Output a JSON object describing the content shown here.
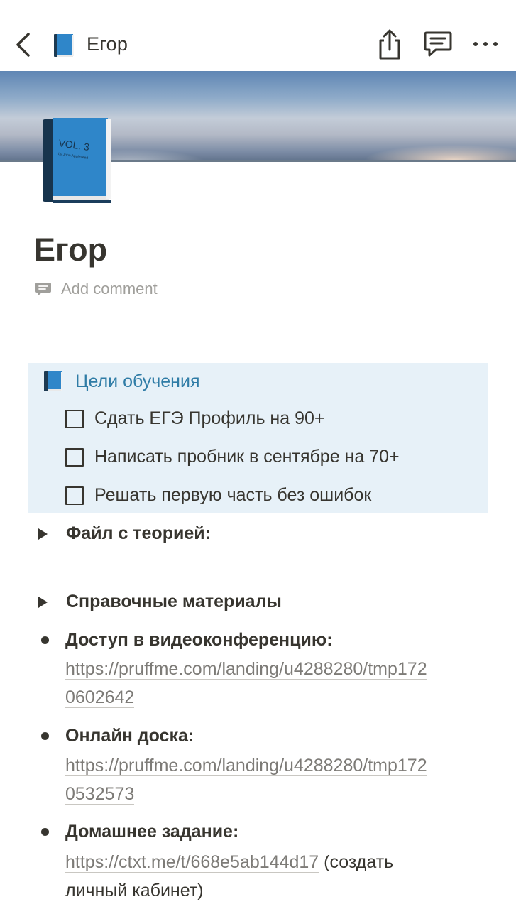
{
  "header": {
    "title": "Егор"
  },
  "page": {
    "title": "Егор",
    "add_comment": "Add comment"
  },
  "callout": {
    "title": "Цели обучения",
    "todos": [
      {
        "label": "Сдать ЕГЭ Профиль на 90+",
        "checked": false
      },
      {
        "label": "Написать пробник в сентябре на 70+",
        "checked": false
      },
      {
        "label": "Решать первую часть без ошибок",
        "checked": false
      }
    ]
  },
  "toggles": [
    {
      "label": "Файл с теорией:"
    },
    {
      "label": "Справочные материалы"
    }
  ],
  "bullets": [
    {
      "label": "Доступ в видеоконференцию:",
      "link_line1": "https://pruffme.com/landing/u4288280/tmp172",
      "link_line2": "0602642"
    },
    {
      "label": "Онлайн доска:",
      "link_line1": "https://pruffme.com/landing/u4288280/tmp172",
      "link_line2": "0532573"
    },
    {
      "label": "Домашнее задание:",
      "link": "https://ctxt.me/t/668e5ab144d17",
      "note_line1": " (создать",
      "note_line2": "личный кабинет)"
    }
  ],
  "icons": {
    "back": "chevron-left-icon",
    "page": "blue-book-icon",
    "share": "share-icon",
    "comments": "comment-icon",
    "more": "more-icon"
  },
  "colors": {
    "callout_bg": "#e7f1f8",
    "callout_title": "#2f7ca6",
    "text": "#37352f",
    "muted": "#a09f9b"
  }
}
